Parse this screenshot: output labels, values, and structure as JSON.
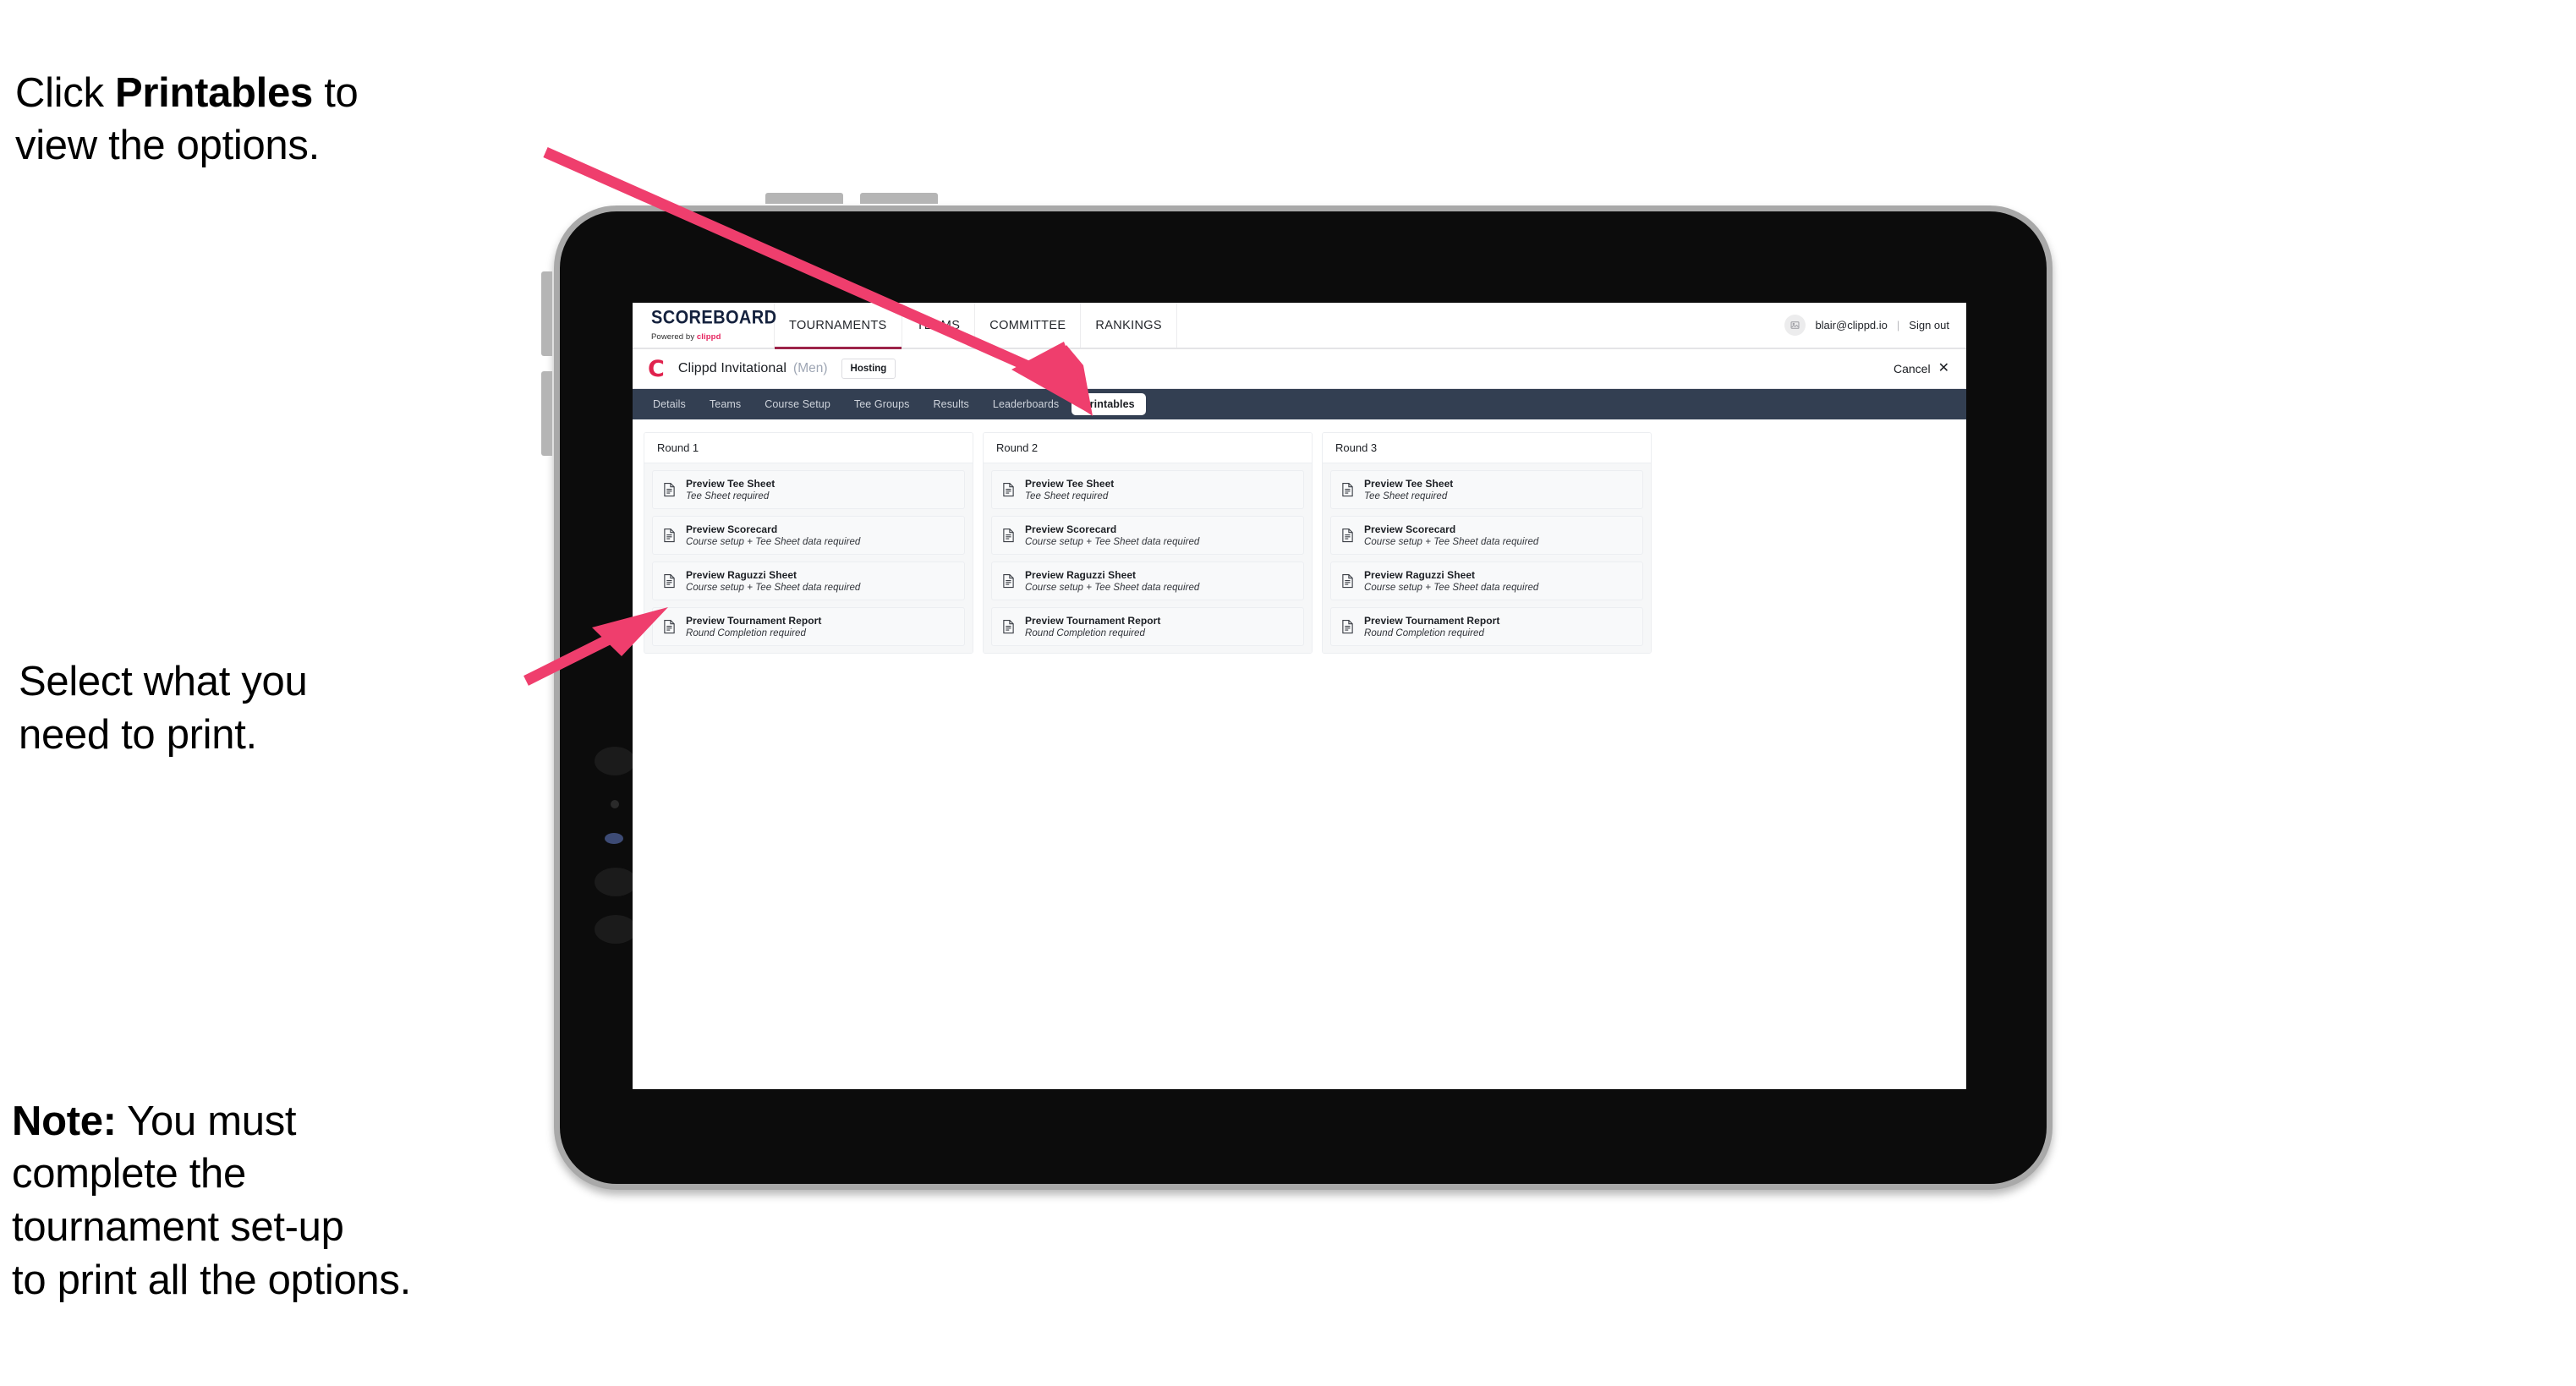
{
  "annotations": {
    "click_printables": {
      "prefix": "Click ",
      "bold": "Printables",
      "suffix": " to\nview the options."
    },
    "select_print": "Select what you\n need to print.",
    "note": {
      "bold": "Note:",
      "rest": " You must\ncomplete the\ntournament set-up\nto print all the options."
    }
  },
  "colors": {
    "accent_pink": "#ef3e6d",
    "brand_red": "#e0234e",
    "navbar_dark": "#333f52",
    "active_underline": "#9d2449"
  },
  "app": {
    "brand": {
      "title": "SCOREBOARD",
      "powered_prefix": "Powered by ",
      "powered_name": "clippd"
    },
    "topnav": [
      {
        "label": "TOURNAMENTS",
        "active": true
      },
      {
        "label": "TEAMS",
        "active": false
      },
      {
        "label": "COMMITTEE",
        "active": false
      },
      {
        "label": "RANKINGS",
        "active": false
      }
    ],
    "user": {
      "avatar_icon": "user-image-icon",
      "email": "blair@clippd.io",
      "separator": "|",
      "signout_label": "Sign out"
    },
    "titlebar": {
      "logo_mark": "C",
      "tournament_name": "Clippd Invitational",
      "gender": "(Men)",
      "hosting_badge": "Hosting",
      "cancel_label": "Cancel",
      "cancel_icon": "✕"
    },
    "tabs": [
      {
        "label": "Details",
        "active": false
      },
      {
        "label": "Teams",
        "active": false
      },
      {
        "label": "Course Setup",
        "active": false
      },
      {
        "label": "Tee Groups",
        "active": false
      },
      {
        "label": "Results",
        "active": false
      },
      {
        "label": "Leaderboards",
        "active": false
      },
      {
        "label": "Printables",
        "active": true
      }
    ],
    "rounds": [
      {
        "header": "Round 1",
        "items": [
          {
            "title": "Preview Tee Sheet",
            "requirement": "Tee Sheet required"
          },
          {
            "title": "Preview Scorecard",
            "requirement": "Course setup + Tee Sheet data required"
          },
          {
            "title": "Preview Raguzzi Sheet",
            "requirement": "Course setup + Tee Sheet data required"
          },
          {
            "title": "Preview Tournament Report",
            "requirement": "Round Completion required"
          }
        ]
      },
      {
        "header": "Round 2",
        "items": [
          {
            "title": "Preview Tee Sheet",
            "requirement": "Tee Sheet required"
          },
          {
            "title": "Preview Scorecard",
            "requirement": "Course setup + Tee Sheet data required"
          },
          {
            "title": "Preview Raguzzi Sheet",
            "requirement": "Course setup + Tee Sheet data required"
          },
          {
            "title": "Preview Tournament Report",
            "requirement": "Round Completion required"
          }
        ]
      },
      {
        "header": "Round 3",
        "items": [
          {
            "title": "Preview Tee Sheet",
            "requirement": "Tee Sheet required"
          },
          {
            "title": "Preview Scorecard",
            "requirement": "Course setup + Tee Sheet data required"
          },
          {
            "title": "Preview Raguzzi Sheet",
            "requirement": "Course setup + Tee Sheet data required"
          },
          {
            "title": "Preview Tournament Report",
            "requirement": "Round Completion required"
          }
        ]
      }
    ]
  }
}
